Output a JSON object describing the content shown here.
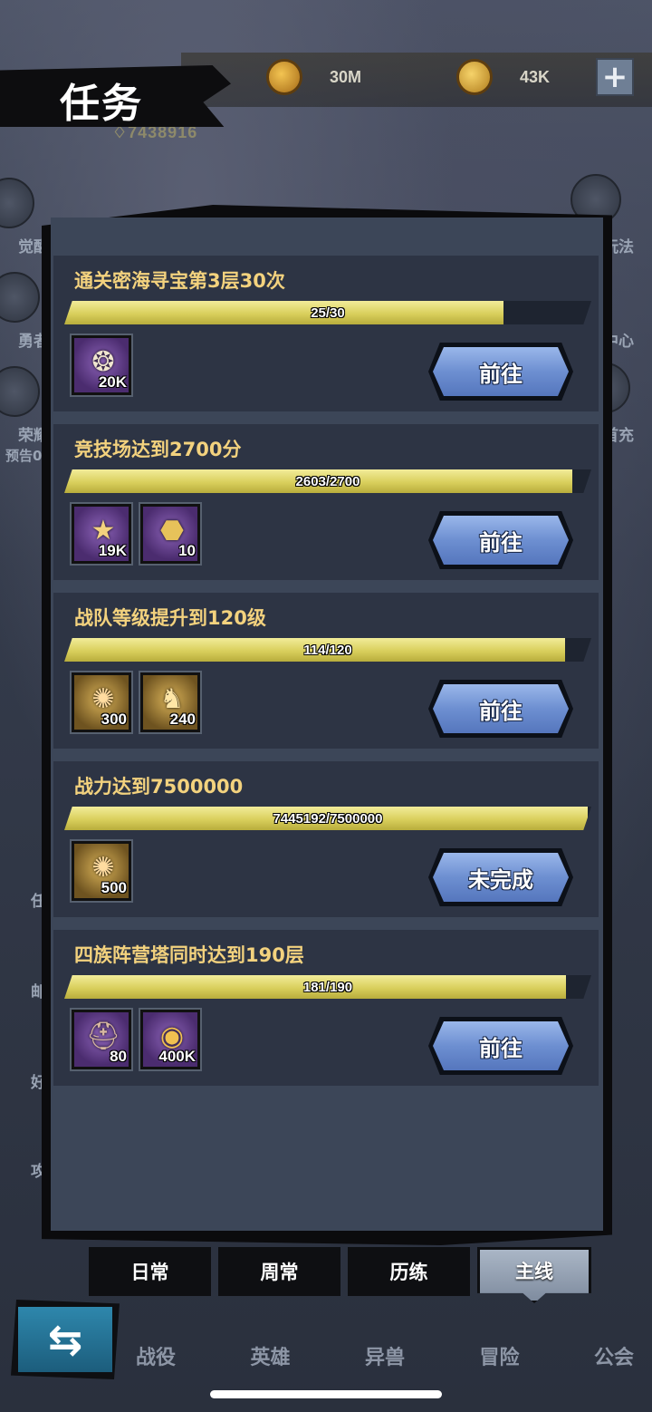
{
  "header": {
    "title": "任务",
    "resources": [
      {
        "icon": "gold-coin-icon",
        "value": "30M"
      },
      {
        "icon": "gem-bag-icon",
        "value": "43K"
      }
    ],
    "power": "7438916"
  },
  "side_labels": [
    "觉醒",
    "勇者",
    "荣耀",
    "预告0",
    "玩法",
    "中心",
    "首充",
    "任",
    "邮",
    "好",
    "攻"
  ],
  "tasks": [
    {
      "title": "通关密海寻宝第3层30次",
      "progress_text": "25/30",
      "progress": 0.8333,
      "rewards": [
        {
          "icon": "silver-coin-bag-icon",
          "qty": "20K",
          "rarity": "purple"
        }
      ],
      "button": "前往"
    },
    {
      "title": "竞技场达到2700分",
      "progress_text": "2603/2700",
      "progress": 0.964,
      "rewards": [
        {
          "icon": "medal-icon",
          "qty": "19K",
          "rarity": "purple"
        },
        {
          "icon": "arena-token-icon",
          "qty": "10",
          "rarity": "purple"
        }
      ],
      "button": "前往"
    },
    {
      "title": "战队等级提升到120级",
      "progress_text": "114/120",
      "progress": 0.95,
      "rewards": [
        {
          "icon": "exp-potion-icon",
          "qty": "300",
          "rarity": "gold"
        },
        {
          "icon": "dragon-statue-icon",
          "qty": "240",
          "rarity": "gold"
        }
      ],
      "button": "前往"
    },
    {
      "title": "战力达到7500000",
      "progress_text": "7445192/7500000",
      "progress": 0.9927,
      "rewards": [
        {
          "icon": "exp-potion-icon",
          "qty": "500",
          "rarity": "gold"
        }
      ],
      "button": "未完成"
    },
    {
      "title": "四族阵营塔同时达到190层",
      "progress_text": "181/190",
      "progress": 0.9526,
      "rewards": [
        {
          "icon": "helmet-icon",
          "qty": "80",
          "rarity": "purple"
        },
        {
          "icon": "gold-coin-icon",
          "qty": "400K",
          "rarity": "purple"
        }
      ],
      "button": "前往"
    }
  ],
  "tabs": [
    "日常",
    "周常",
    "历练",
    "主线"
  ],
  "active_tab": "主线",
  "bottom_nav": [
    "战役",
    "英雄",
    "异兽",
    "冒险",
    "公会"
  ],
  "colors": {
    "task_title": "#f3d27e",
    "progress_fill": "#d9cf5c",
    "button": "#6d8fd1",
    "panel": "#3c4658"
  }
}
